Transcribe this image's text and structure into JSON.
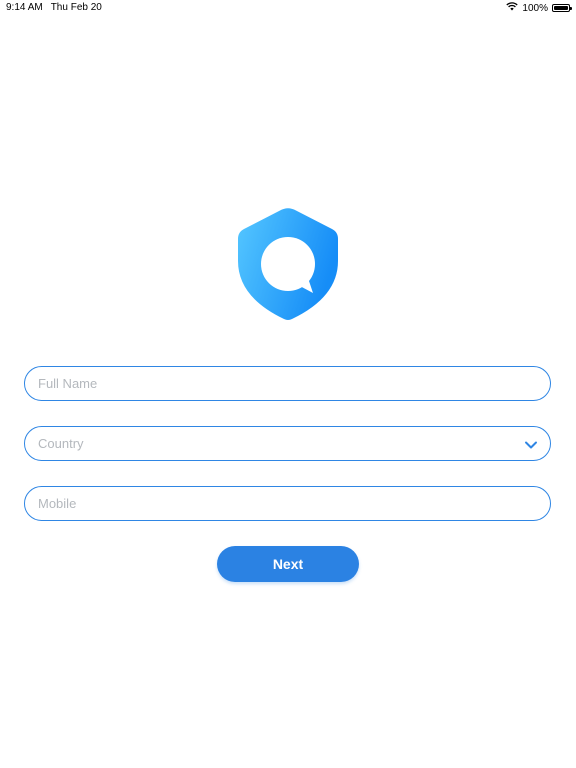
{
  "status_bar": {
    "time": "9:14 AM",
    "date": "Thu Feb 20",
    "battery_text": "100%",
    "wifi_icon": "wifi-icon",
    "battery_icon": "battery-icon"
  },
  "logo": {
    "icon": "shield-chat-icon",
    "gradient_start": "#55c7ff",
    "gradient_end": "#168df7"
  },
  "form": {
    "full_name": {
      "placeholder": "Full Name",
      "value": ""
    },
    "country": {
      "placeholder": "Country",
      "value": "",
      "dropdown_icon": "chevron-down-icon"
    },
    "mobile": {
      "placeholder": "Mobile",
      "value": ""
    },
    "next_label": "Next"
  },
  "colors": {
    "accent": "#2b82e3",
    "border": "#2f86e4",
    "placeholder": "#b4b8bd"
  }
}
